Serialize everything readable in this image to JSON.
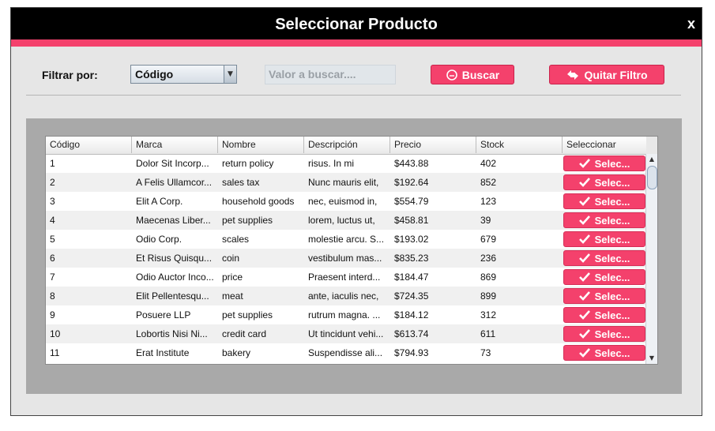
{
  "window": {
    "title": "Seleccionar Producto",
    "close_label": "x"
  },
  "filter": {
    "label": "Filtrar por:",
    "selected": "Código",
    "search_placeholder": "Valor a buscar....",
    "search_button": "Buscar",
    "clear_button": "Quitar Filtro"
  },
  "table": {
    "columns": [
      "Código",
      "Marca",
      "Nombre",
      "Descripción",
      "Precio",
      "Stock",
      "Seleccionar"
    ],
    "select_label": "Selec...",
    "rows": [
      [
        "1",
        "Dolor Sit Incorp...",
        "return policy",
        "risus. In mi",
        "$443.88",
        "402"
      ],
      [
        "2",
        "A Felis Ullamcor...",
        "sales tax",
        "Nunc mauris elit,",
        "$192.64",
        "852"
      ],
      [
        "3",
        "Elit A Corp.",
        "household goods",
        "nec, euismod in,",
        "$554.79",
        "123"
      ],
      [
        "4",
        "Maecenas Liber...",
        "pet supplies",
        "lorem, luctus ut,",
        "$458.81",
        "39"
      ],
      [
        "5",
        "Odio Corp.",
        "scales",
        "molestie arcu. S...",
        "$193.02",
        "679"
      ],
      [
        "6",
        "Et Risus Quisqu...",
        "coin",
        "vestibulum mas...",
        "$835.23",
        "236"
      ],
      [
        "7",
        "Odio Auctor Inco...",
        "price",
        "Praesent interd...",
        "$184.47",
        "869"
      ],
      [
        "8",
        "Elit Pellentesqu...",
        "meat",
        "ante, iaculis nec,",
        "$724.35",
        "899"
      ],
      [
        "9",
        "Posuere LLP",
        "pet supplies",
        "rutrum magna. ...",
        "$184.12",
        "312"
      ],
      [
        "10",
        "Lobortis Nisi Ni...",
        "credit card",
        "Ut tincidunt vehi...",
        "$613.74",
        "611"
      ],
      [
        "11",
        "Erat Institute",
        "bakery",
        "Suspendisse ali...",
        "$794.93",
        "73"
      ]
    ]
  },
  "colors": {
    "accent": "#f4416c",
    "titlebar": "#000000",
    "panel": "#a9a9a9"
  }
}
